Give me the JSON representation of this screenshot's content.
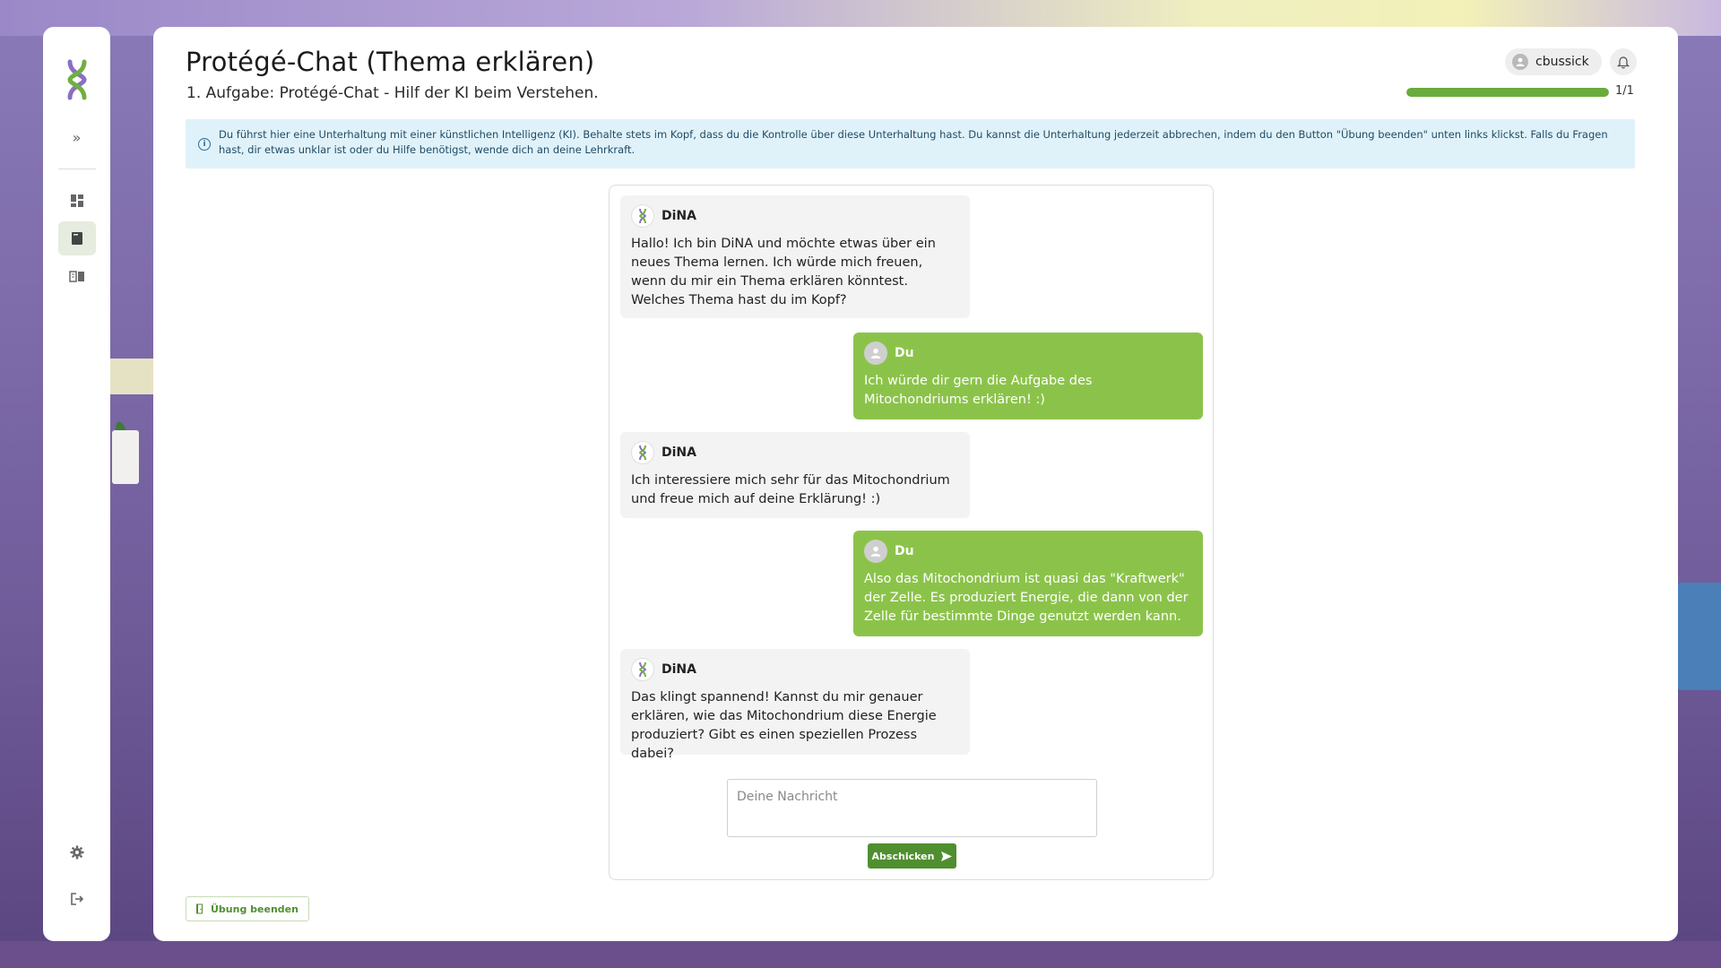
{
  "header": {
    "title": "Protégé-Chat (Thema erklären)",
    "subtitle": "1. Aufgabe: Protégé-Chat - Hilf der KI beim Verstehen.",
    "username": "cbussick",
    "progress_text": "1/1",
    "progress_fraction": 1.0
  },
  "info": {
    "text": "Du führst hier eine Unterhaltung mit einer künstlichen Intelligenz (KI). Behalte stets im Kopf, dass du die Kontrolle über diese Unterhaltung hast. Du kannst die Unterhaltung jederzeit abbrechen, indem du den Button \"Übung beenden\" unten links klickst. Falls du Fragen hast, dir etwas unklar ist oder du Hilfe benötigst, wende dich an deine Lehrkraft."
  },
  "chat": {
    "messages": [
      {
        "sender": "DiNA",
        "role": "bot",
        "text": "Hallo! Ich bin DiNA und möchte etwas über ein neues Thema lernen. Ich würde mich freuen, wenn du mir ein Thema erklären könntest. Welches Thema hast du im Kopf?"
      },
      {
        "sender": "Du",
        "role": "user",
        "text": "Ich würde dir gern die Aufgabe des Mitochondriums erklären! :)"
      },
      {
        "sender": "DiNA",
        "role": "bot",
        "text": "Ich interessiere mich sehr für das Mitochondrium und freue mich auf deine Erklärung! :)"
      },
      {
        "sender": "Du",
        "role": "user",
        "text": "Also das Mitochondrium ist quasi das \"Kraftwerk\" der Zelle. Es produziert Energie, die dann von der Zelle für bestimmte Dinge genutzt werden kann."
      },
      {
        "sender": "DiNA",
        "role": "bot",
        "text": "Das klingt spannend! Kannst du mir genauer erklären, wie das Mitochondrium diese Energie produziert? Gibt es einen speziellen Prozess dabei?"
      }
    ],
    "input_placeholder": "Deine Nachricht",
    "input_value": "",
    "send_label": "Abschicken"
  },
  "footer": {
    "end_label": "Übung beenden"
  },
  "icons": {
    "logo": "dna-logo-icon",
    "expand": "double-chevron-right-icon",
    "nav": [
      "dashboard-icon",
      "book-icon",
      "open-book-icon"
    ],
    "bottom": [
      "gear-icon",
      "logout-icon"
    ],
    "bell": "bell-icon",
    "info": "info-icon",
    "send": "send-arrow-icon",
    "end": "exit-door-icon"
  },
  "colors": {
    "accent": "#8bc34a",
    "button": "#4f8f2f",
    "info_bg": "#e0f2f9",
    "progress": "#6aab3d"
  }
}
